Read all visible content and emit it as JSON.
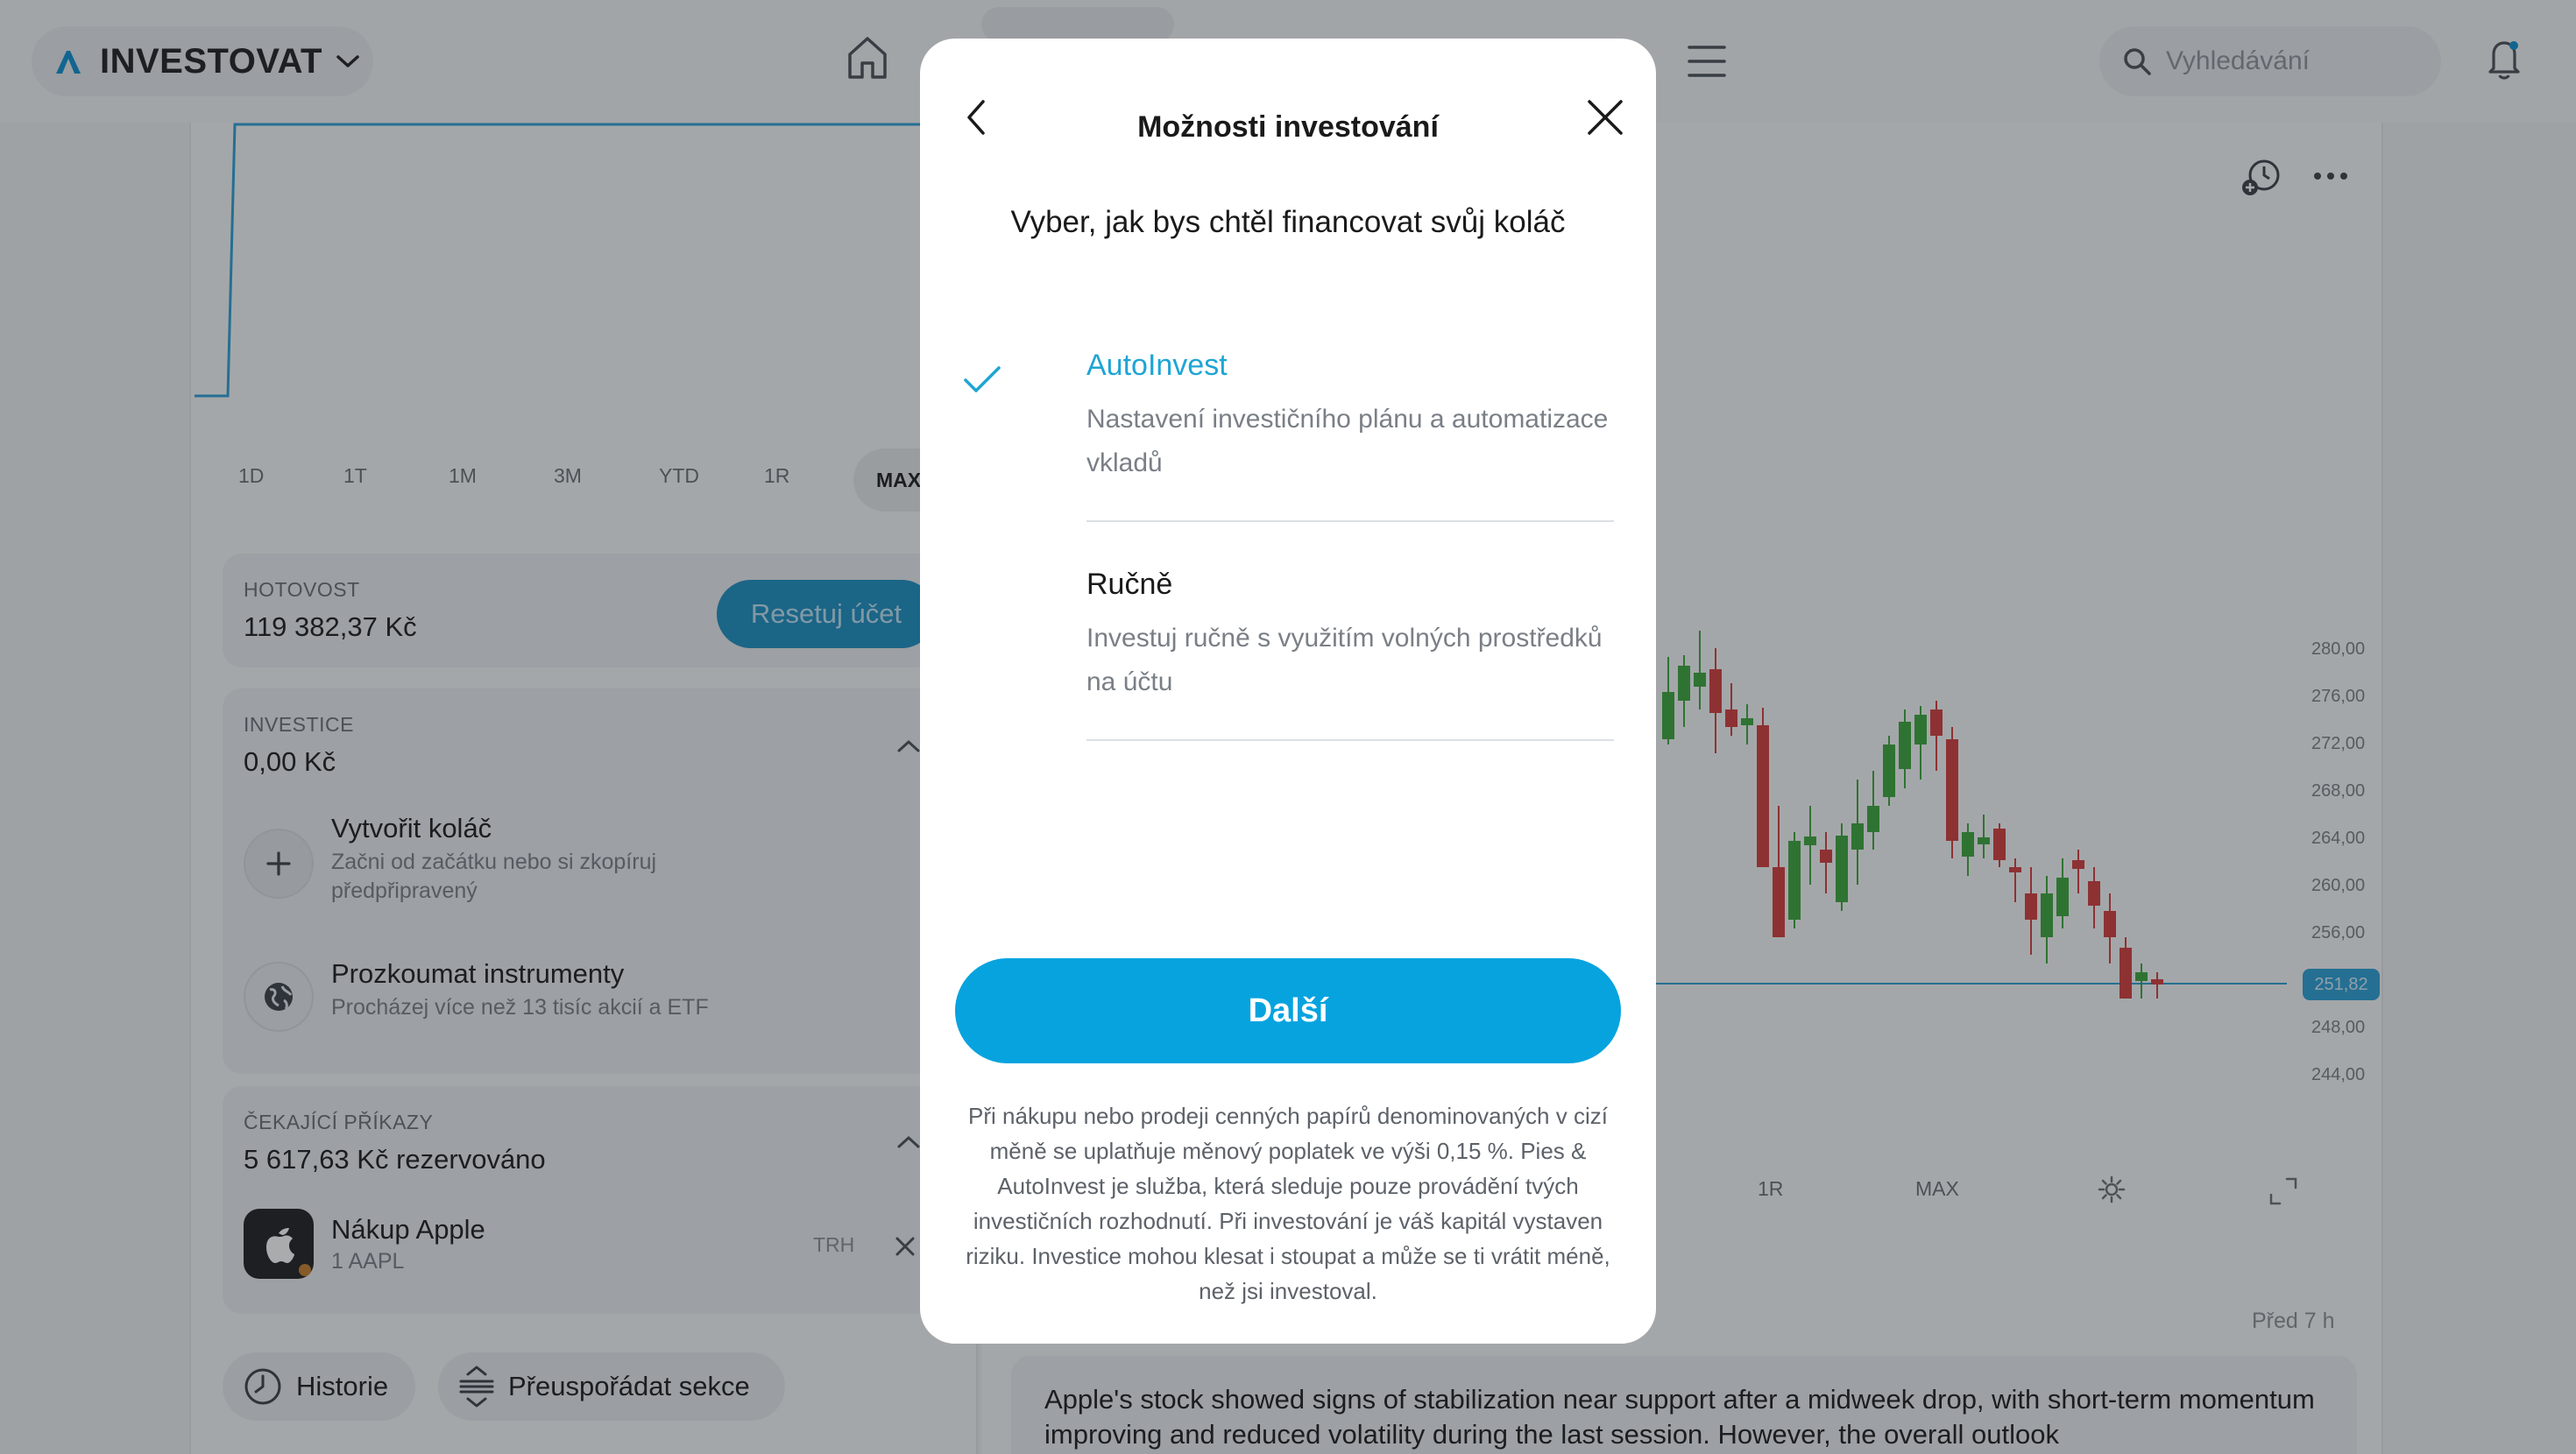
{
  "nav": {
    "brand": "INVESTOVAT",
    "search_placeholder": "Vyhledávání"
  },
  "left": {
    "ranges": [
      "1D",
      "1T",
      "1M",
      "3M",
      "YTD",
      "1R"
    ],
    "range_active": "MAX",
    "cash": {
      "label": "HOTOVOST",
      "value": "119 382,37 Kč",
      "reset_label": "Resetuj účet"
    },
    "investments": {
      "label": "INVESTICE",
      "value": "0,00 Kč",
      "create": {
        "title": "Vytvořit koláč",
        "subtitle": "Začni od začátku nebo si zkopíruj předpřipravený"
      },
      "explore": {
        "title": "Prozkoumat instrumenty",
        "subtitle": "Procházej více než 13 tisíc akcií a ETF"
      }
    },
    "pending": {
      "label": "ČEKAJÍCÍ PŘÍKAZY",
      "value": "5 617,63 Kč rezervováno",
      "order": {
        "title": "Nákup Apple",
        "subtitle": "1 AAPL",
        "type": "TRH"
      }
    },
    "history_label": "Historie",
    "reorder_label": "Přeuspořádat sekce"
  },
  "right": {
    "price_labels": [
      "280,00",
      "276,00",
      "272,00",
      "268,00",
      "264,00",
      "260,00",
      "256,00",
      "248,00",
      "244,00"
    ],
    "current_price": "251,82",
    "ranges": [
      "1R",
      "MAX"
    ],
    "time_ago": "Před 7 h",
    "news_text": "Apple's stock showed signs of stabilization near support after a midweek drop, with short-term momentum improving and reduced volatility during the last session. However, the overall outlook"
  },
  "modal": {
    "title": "Možnosti investování",
    "subtitle": "Vyber, jak bys chtěl financovat svůj koláč",
    "options": [
      {
        "title": "AutoInvest",
        "desc": "Nastavení investičního plánu a automatizace vkladů",
        "selected": true
      },
      {
        "title": "Ručně",
        "desc": "Investuj ručně s využitím volných prostředků na účtu",
        "selected": false
      }
    ],
    "next_label": "Další",
    "disclaimer": "Při nákupu nebo prodeji cenných papírů denominovaných v cizí měně se uplatňuje měnový poplatek ve výši 0,15 %. Pies & AutoInvest je služba, která sleduje pouze provádění tvých investičních rozhodnutí. Při investování je váš kapitál vystaven riziku. Investice mohou klesat i stoupat a může se ti vrátit méně, než jsi investoval."
  },
  "colors": {
    "accent": "#06a3df",
    "selected_text": "#1ea5d4",
    "candle_up": "#3aa53a",
    "candle_down": "#d33b3b"
  }
}
